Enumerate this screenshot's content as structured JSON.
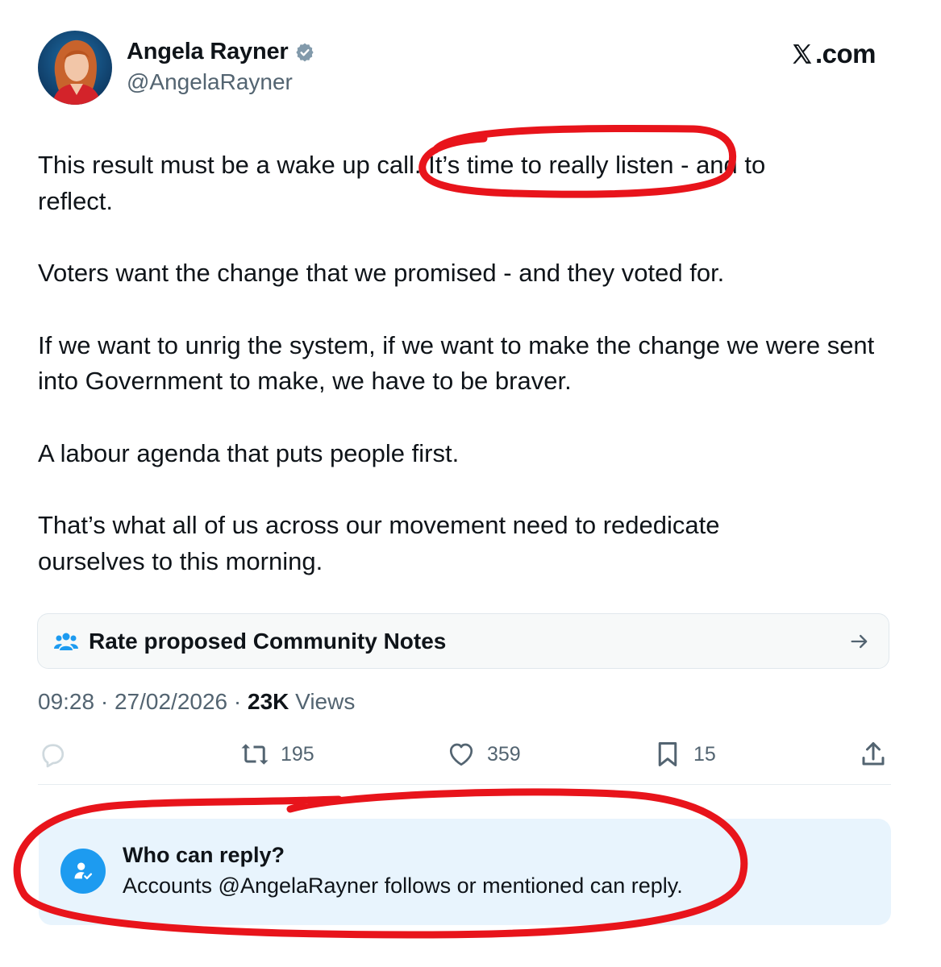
{
  "author": {
    "name": "Angela Rayner",
    "handle": "@AngelaRayner",
    "verified": true
  },
  "brand": {
    "site": ".com",
    "logo_icon": "x-logo-icon"
  },
  "tweet": {
    "paragraphs": [
      "This result must be a wake up call. It’s time to really listen - and to",
      "reflect.",
      "Voters want the change that we promised - and they voted for.",
      "If we want to unrig the system, if we want to make the change we were sent into Government to make, we have to be braver.",
      "A labour agenda that puts people first.",
      "That’s what all of us across our movement need to rededicate ourselves to this morning."
    ]
  },
  "community_notes": {
    "label": "Rate proposed Community Notes",
    "icon": "people-group-icon",
    "arrow_icon": "arrow-right-icon"
  },
  "meta": {
    "time": "09:28",
    "separator": " · ",
    "date": "27/02/2026",
    "views_count": "23K",
    "views_label": " Views"
  },
  "actions": {
    "reply_count": "",
    "retweet_count": "195",
    "like_count": "359",
    "bookmark_count": "15"
  },
  "reply_restriction": {
    "title": "Who can reply?",
    "description": "Accounts @AngelaRayner follows or mentioned can reply."
  },
  "colors": {
    "accent": "#1d9bf0",
    "annotation_red": "#e8141b",
    "secondary_text": "#536471",
    "reply_box_bg": "#e8f4fd"
  }
}
